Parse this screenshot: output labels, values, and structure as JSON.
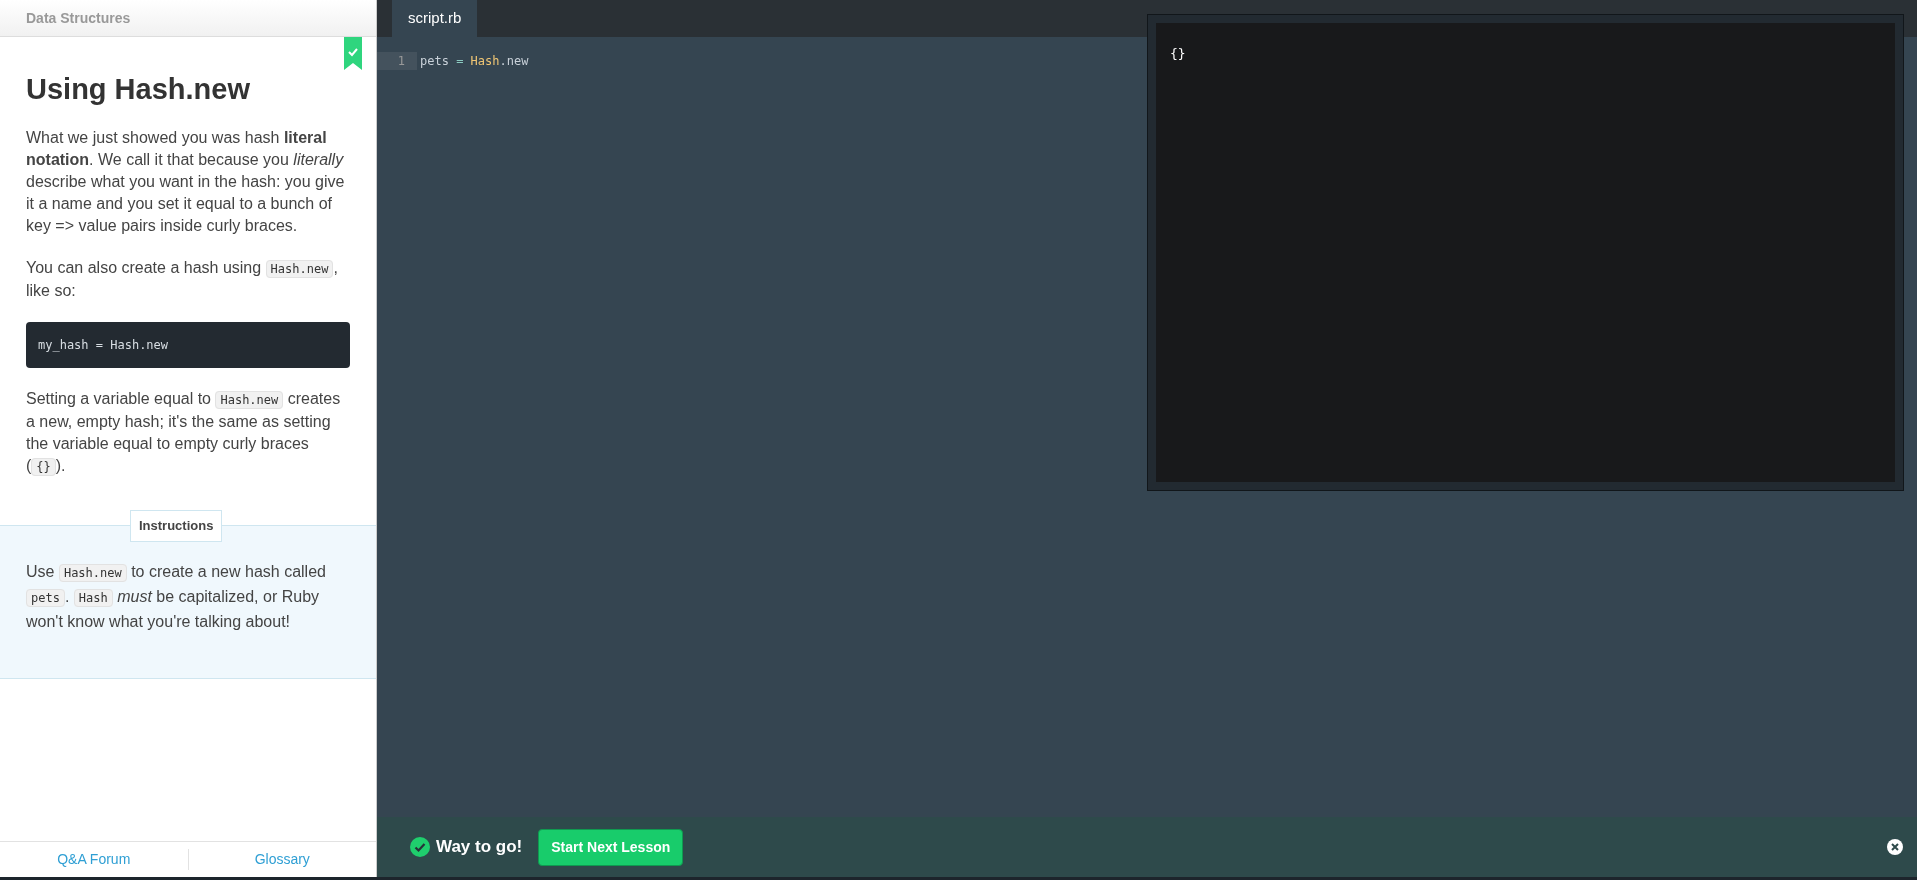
{
  "sidebar": {
    "section_title": "Data Structures",
    "completed": true,
    "title": "Using Hash.new",
    "paragraphs": [
      [
        {
          "kind": "text",
          "text": "What we just showed you was hash **literal notation**. We call it that because you *literally* describe what you want in the hash: you give it a name and you set it equal to a bunch of key => value pairs inside curly braces."
        }
      ],
      [
        {
          "kind": "text",
          "text": "You can also create a hash using "
        },
        {
          "kind": "code",
          "text": "Hash.new"
        },
        {
          "kind": "text",
          "text": ", like so:"
        }
      ],
      [
        {
          "kind": "block",
          "text": "my_hash = Hash.new"
        }
      ],
      [
        {
          "kind": "text",
          "text": "Setting a variable equal to "
        },
        {
          "kind": "code",
          "text": "Hash.new"
        },
        {
          "kind": "text",
          "text": " creates a new, empty hash; it's the same as setting the variable equal to empty curly braces ("
        },
        {
          "kind": "code",
          "text": "{}"
        },
        {
          "kind": "text",
          "text": ")."
        }
      ]
    ],
    "instructions": {
      "label": "Instructions",
      "paragraph": [
        {
          "kind": "text",
          "text": "Use "
        },
        {
          "kind": "code",
          "text": "Hash.new"
        },
        {
          "kind": "text",
          "text": " to create a new hash called "
        },
        {
          "kind": "code",
          "text": "pets"
        },
        {
          "kind": "text",
          "text": ". "
        },
        {
          "kind": "code",
          "text": "Hash"
        },
        {
          "kind": "text",
          "text": " *must* be capitalized, or Ruby won't know what you're talking about!"
        }
      ]
    },
    "footer_links": [
      "Q&A Forum",
      "Glossary"
    ]
  },
  "editor": {
    "tabs": [
      {
        "label": "script.rb",
        "selected": true
      }
    ],
    "lines": [
      {
        "number": "1",
        "tokens": [
          {
            "kind": "ident",
            "text": "pets"
          },
          {
            "kind": "op",
            "text": " = "
          },
          {
            "kind": "const",
            "text": "Hash"
          },
          {
            "kind": "ident",
            "text": ".new"
          }
        ]
      }
    ]
  },
  "console": {
    "output": "{}"
  },
  "success_bar": {
    "message": "Way to go!",
    "button": "Start Next Lesson"
  }
}
